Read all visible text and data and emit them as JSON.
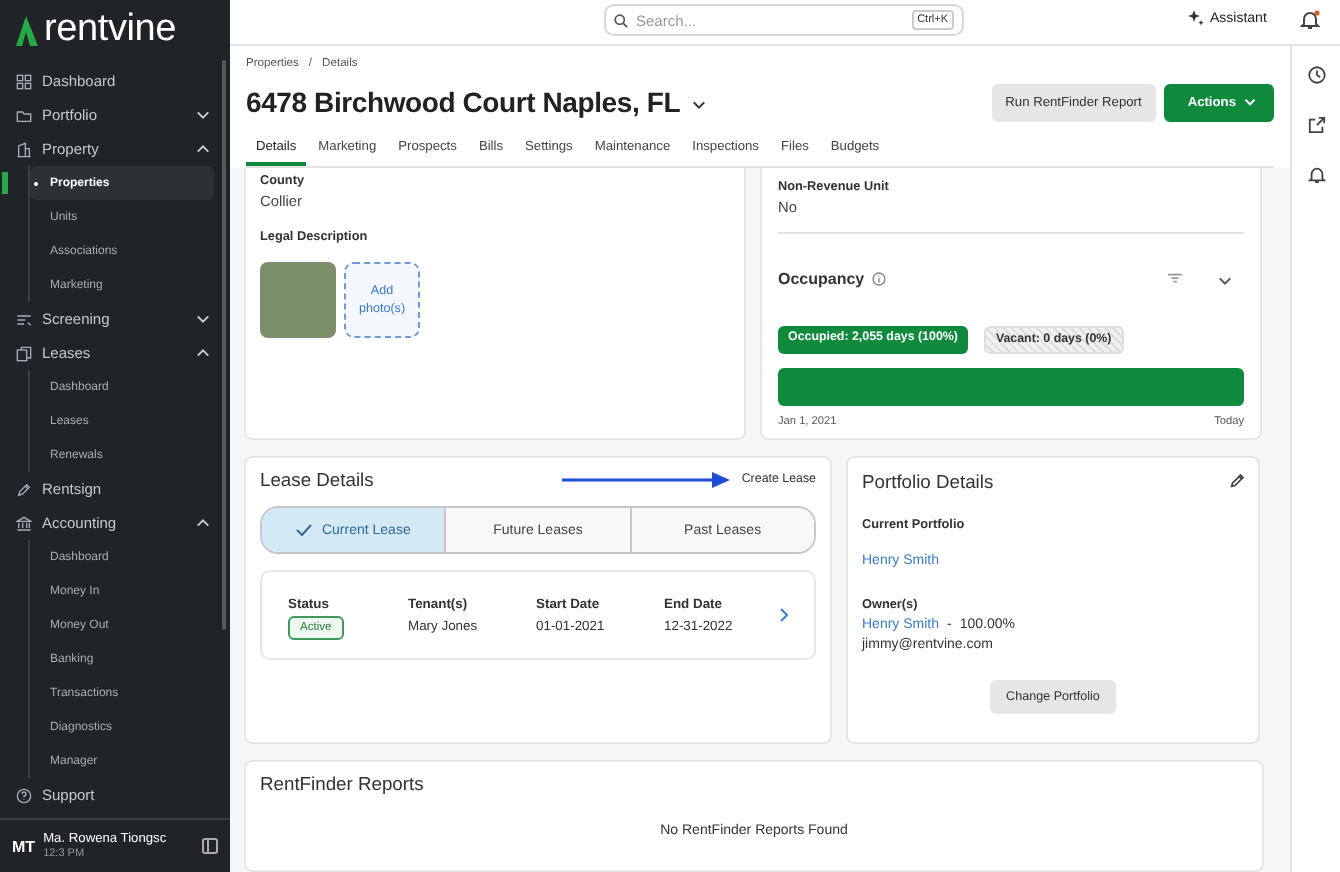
{
  "sidebar": {
    "logo": "rentvine",
    "items": [
      {
        "label": "Dashboard"
      },
      {
        "label": "Portfolio",
        "expanded": false
      },
      {
        "label": "Property",
        "expanded": true,
        "children": [
          {
            "label": "Properties",
            "selected": true
          },
          {
            "label": "Units",
            "selected": false
          },
          {
            "label": "Associations",
            "selected": false
          },
          {
            "label": "Marketing",
            "selected": false
          }
        ]
      },
      {
        "label": "Screening",
        "expanded": false
      },
      {
        "label": "Leases",
        "expanded": true,
        "children": [
          {
            "label": "Dashboard",
            "selected": false
          },
          {
            "label": "Leases",
            "selected": false
          },
          {
            "label": "Renewals",
            "selected": false
          }
        ]
      },
      {
        "label": "Rentsign"
      },
      {
        "label": "Accounting",
        "expanded": true,
        "children": [
          {
            "label": "Dashboard",
            "selected": false
          },
          {
            "label": "Money In",
            "selected": false
          },
          {
            "label": "Money Out",
            "selected": false
          },
          {
            "label": "Banking",
            "selected": false
          },
          {
            "label": "Transactions",
            "selected": false
          },
          {
            "label": "Diagnostics",
            "selected": false
          },
          {
            "label": "Manager",
            "selected": false
          }
        ]
      },
      {
        "label": "Support"
      }
    ],
    "user": {
      "initials": "MT",
      "name": "Ma. Rowena Tiongsc",
      "time": "12:3 PM"
    }
  },
  "topbar": {
    "search": {
      "placeholder": "Search...",
      "shortcut": "Ctrl+K"
    },
    "assistant": "Assistant",
    "notification": true
  },
  "breadcrumb": [
    "Properties",
    "Details"
  ],
  "breadcrumb_separator": "/",
  "title": "6478 Birchwood Court Naples, FL",
  "header_buttons": [
    {
      "label": "Run RentFinder Report",
      "kind": "secondary"
    },
    {
      "label": "Actions",
      "kind": "primary"
    }
  ],
  "tabs": [
    {
      "label": "Details",
      "selected": true
    },
    {
      "label": "Marketing",
      "selected": false
    },
    {
      "label": "Prospects",
      "selected": false
    },
    {
      "label": "Bills",
      "selected": false
    },
    {
      "label": "Settings",
      "selected": false
    },
    {
      "label": "Maintenance",
      "selected": false
    },
    {
      "label": "Inspections",
      "selected": false
    },
    {
      "label": "Files",
      "selected": false
    },
    {
      "label": "Budgets",
      "selected": false
    }
  ],
  "details_card": {
    "fields": [
      {
        "label": "County",
        "value": "Collier"
      }
    ],
    "legal_label": "Legal Description",
    "add_photo": "Add photo(s)"
  },
  "occupancy_card": {
    "fields": [
      {
        "label": "Non-Revenue Unit",
        "value": "No"
      }
    ],
    "title": "Occupancy",
    "occupied": "Occupied: 2,055 days (100%)",
    "vacant": "Vacant: 0 days (0%)",
    "level": 1,
    "start": "Jan 1, 2021",
    "end": "Today"
  },
  "lease_details": {
    "title": "Lease Details",
    "action": "Create Lease",
    "tabs": [
      {
        "label": "Current Lease",
        "selected": true
      },
      {
        "label": "Future Leases",
        "selected": false
      },
      {
        "label": "Past Leases",
        "selected": false
      }
    ],
    "columns": [
      "Status",
      "Tenant(s)",
      "Start Date",
      "End Date"
    ],
    "lease": {
      "status": "Active",
      "tenant": "Mary Jones",
      "start": "01-01-2021",
      "end": "12-31-2022"
    }
  },
  "portfolio_details": {
    "title": "Portfolio Details",
    "current_label": "Current Portfolio",
    "current": "Henry Smith",
    "owners_label": "Owner(s)",
    "owner": "Henry Smith",
    "share_separator": "-",
    "share": "100.00%",
    "email": "jimmy@rentvine.com",
    "button": "Change Portfolio"
  },
  "rentfinder": {
    "title": "RentFinder Reports",
    "empty": "No RentFinder Reports Found"
  }
}
